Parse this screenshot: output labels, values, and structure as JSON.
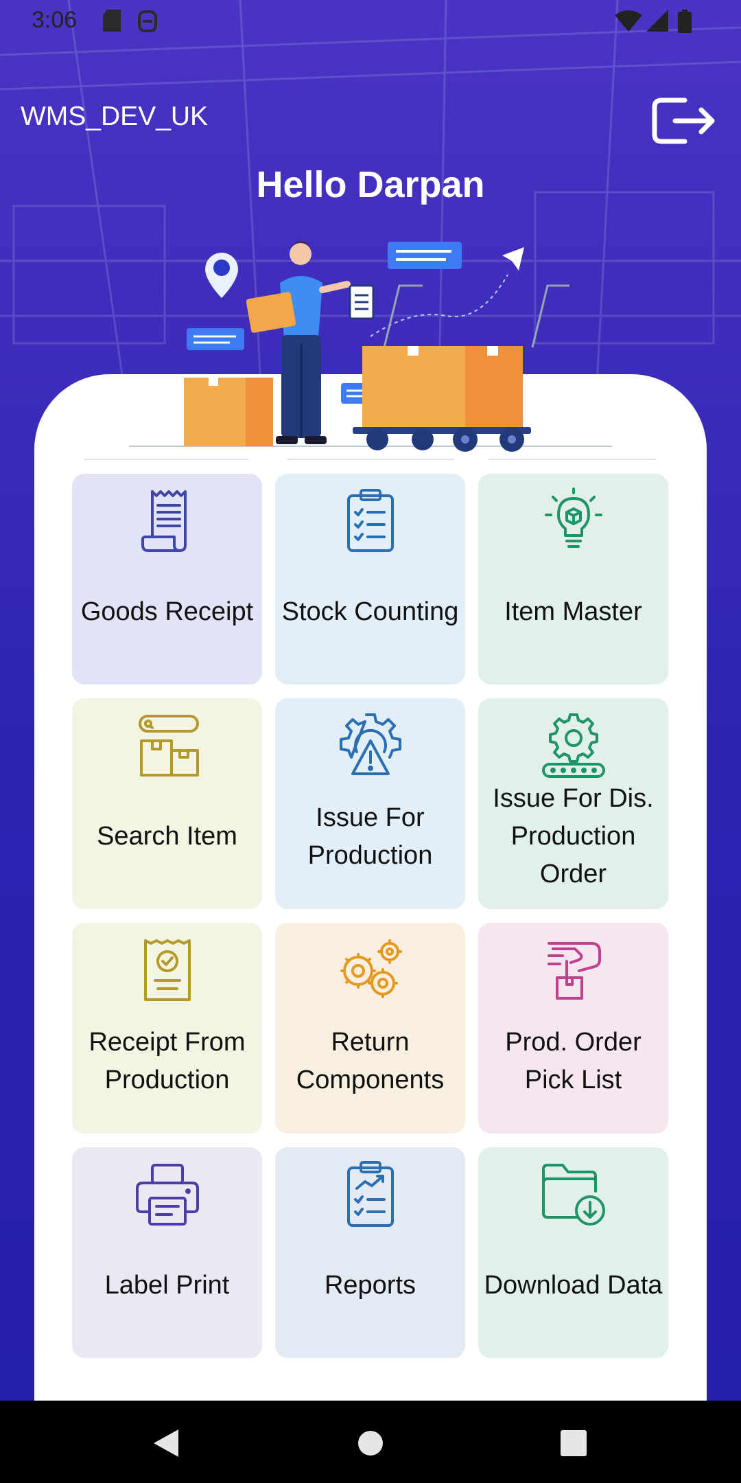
{
  "status_bar": {
    "time": "3:06",
    "icons": [
      "sd-card-icon",
      "notification-icon",
      "wifi-icon",
      "signal-icon",
      "battery-icon"
    ]
  },
  "header": {
    "app_title": "WMS_DEV_UK",
    "greeting": "Hello Darpan",
    "logout_icon": "logout-icon"
  },
  "colors": {
    "header_bg": "#3a2bb8",
    "panel_bg": "#ffffff"
  },
  "menu": [
    {
      "label": "Goods Receipt",
      "icon": "receipt-icon",
      "bg": "#e3e3f7",
      "fg": "#3f46a8"
    },
    {
      "label": "Stock Counting",
      "icon": "clipboard-checklist-icon",
      "bg": "#e3eff8",
      "fg": "#2a6fb2"
    },
    {
      "label": "Item Master",
      "icon": "lightbulb-box-icon",
      "bg": "#e2f0ea",
      "fg": "#1e9468"
    },
    {
      "label": "Search Item",
      "icon": "search-boxes-icon",
      "bg": "#f4f4e2",
      "fg": "#b39a2a"
    },
    {
      "label": "Issue For Production",
      "icon": "gear-warning-icon",
      "bg": "#e3eff8",
      "fg": "#2a6fb2"
    },
    {
      "label": "Issue For Dis. Production Order",
      "icon": "gear-conveyor-icon",
      "bg": "#e2f0ea",
      "fg": "#1e9468"
    },
    {
      "label": "Receipt From Production",
      "icon": "receipt-check-icon",
      "bg": "#f4f4e2",
      "fg": "#b39a2a"
    },
    {
      "label": "Return Components",
      "icon": "gears-icon",
      "bg": "#f8efe1",
      "fg": "#e59a1e"
    },
    {
      "label": "Prod. Order Pick List",
      "icon": "hand-pick-box-icon",
      "bg": "#f5e6f0",
      "fg": "#c0408e"
    },
    {
      "label": "Label Print",
      "icon": "printer-icon",
      "bg": "#ebe8f4",
      "fg": "#4a3fa8"
    },
    {
      "label": "Reports",
      "icon": "report-chart-icon",
      "bg": "#e3eaf3",
      "fg": "#2a6fb2"
    },
    {
      "label": "Download Data",
      "icon": "folder-download-icon",
      "bg": "#e2f0ea",
      "fg": "#1e9468"
    }
  ],
  "nav": {
    "icons": [
      "back-icon",
      "home-icon",
      "recents-icon"
    ]
  }
}
